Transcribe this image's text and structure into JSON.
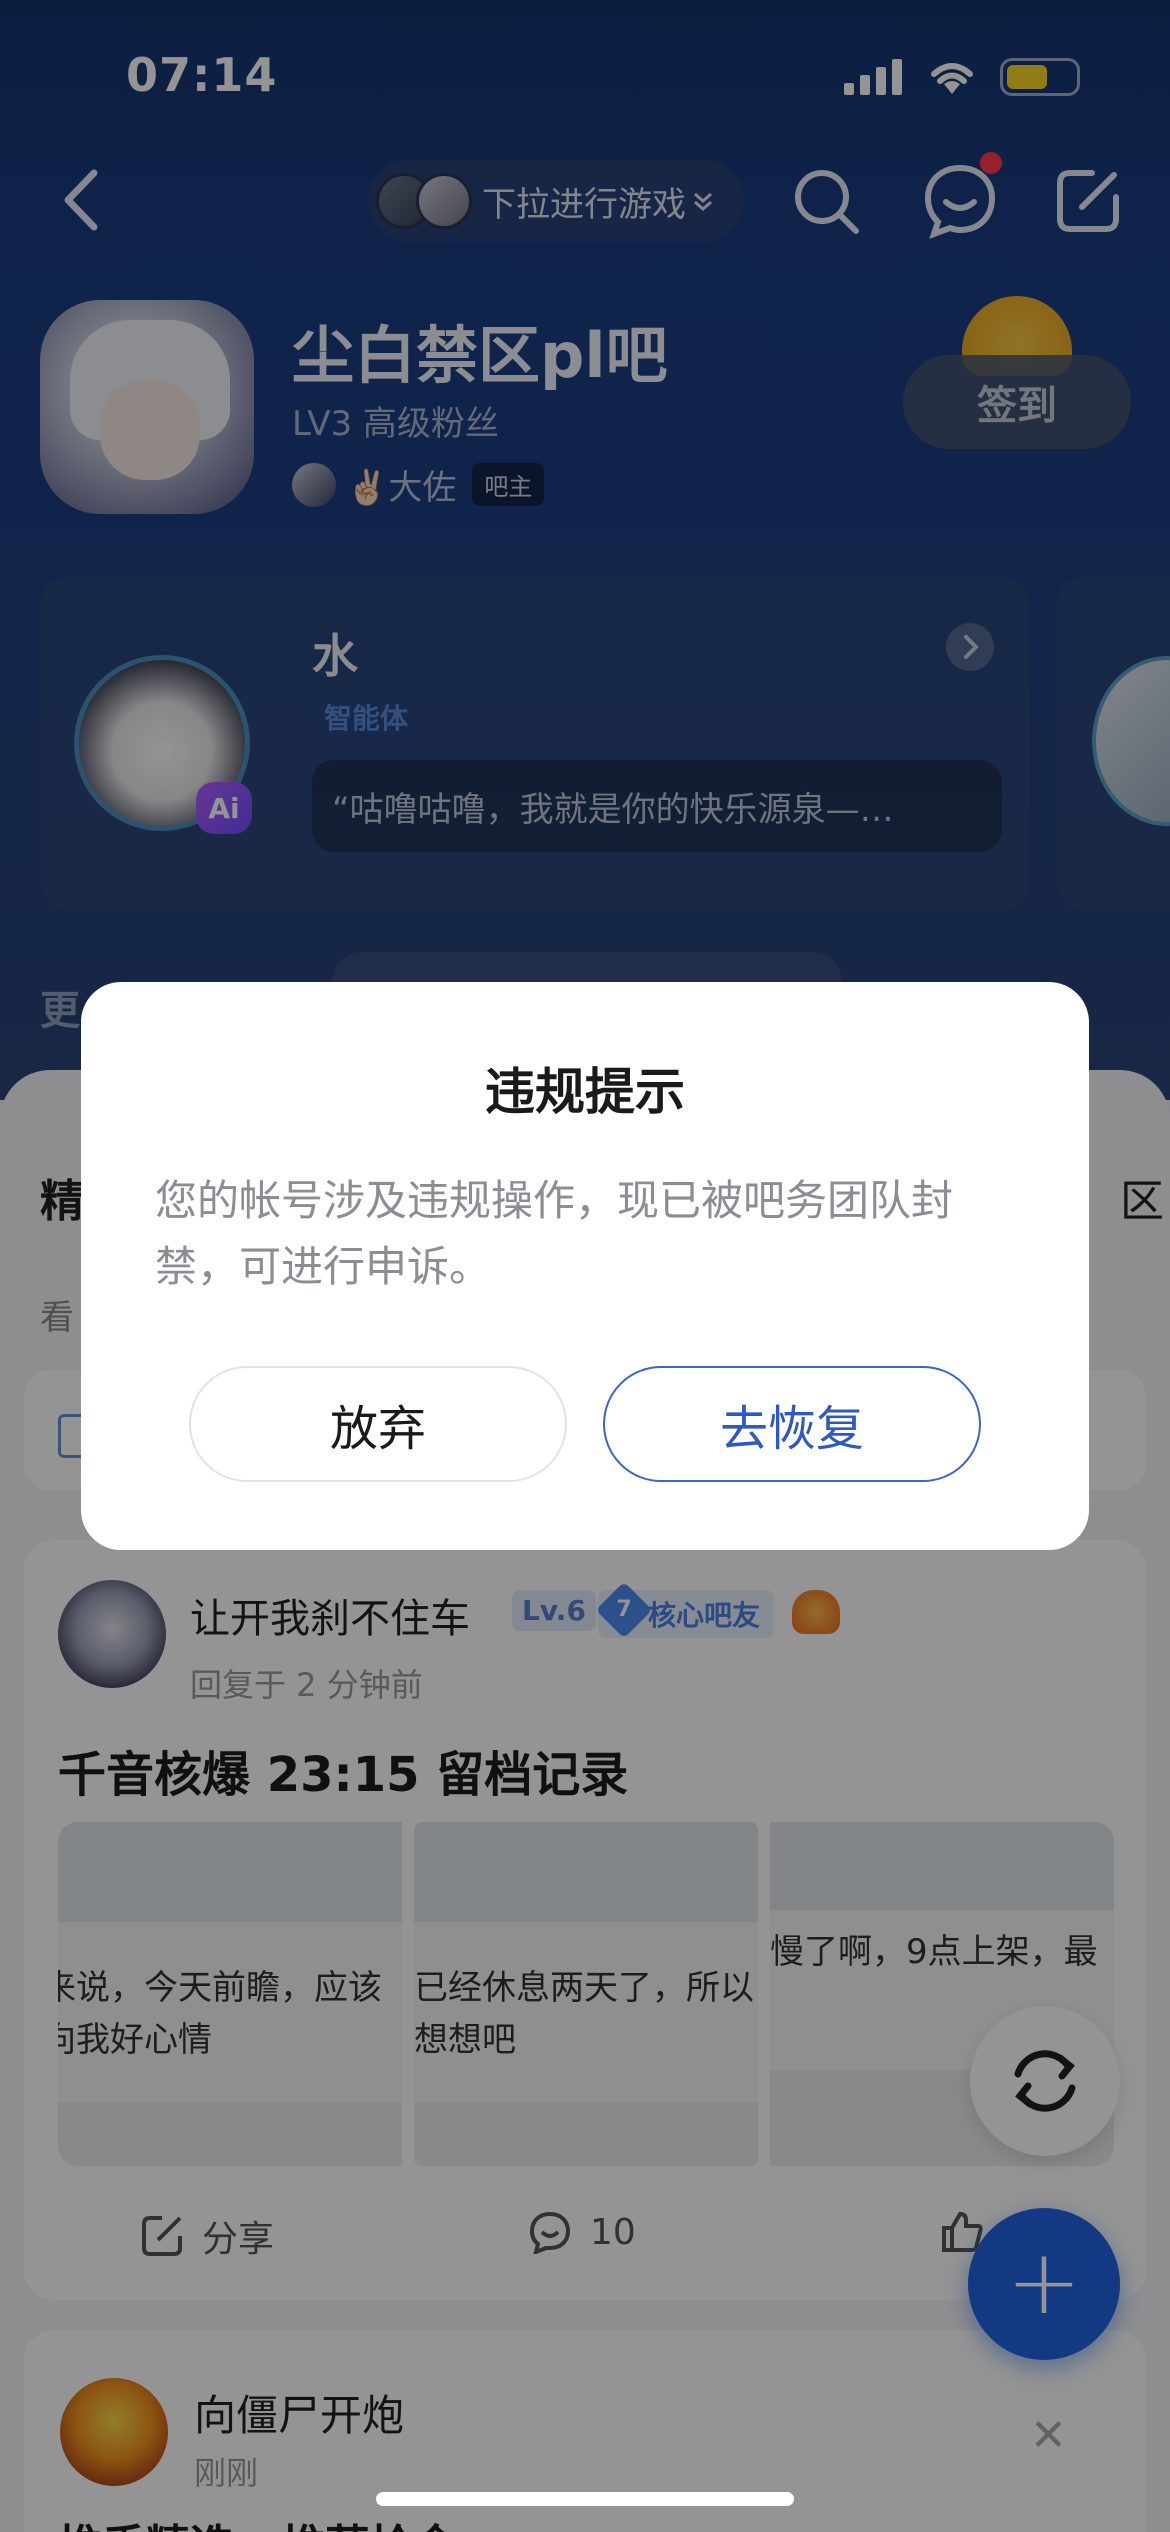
{
  "status_bar": {
    "time": "07:14"
  },
  "top_nav": {
    "game_pill_label": "下拉进行游戏"
  },
  "forum": {
    "name": "尘白禁区pl吧",
    "level": "LV3 高级粉丝",
    "owner_name": "✌🏻大佐",
    "owner_badge": "吧主",
    "checkin_label": "签到"
  },
  "agent_card": {
    "name": "水",
    "tag": "智能体",
    "quote": "“咕噜咕噜，我就是你的快乐源泉—…",
    "ai_badge": "Ai"
  },
  "background_fragments": {
    "more_text": "更",
    "tab_left": "精",
    "tab_right": "区",
    "sort_left": "看"
  },
  "post": {
    "author": "让开我刹不住车",
    "level_badge": "Lv.6",
    "core_badge_num": "7",
    "core_badge": "核心吧友",
    "time": "回复于 2 分钟前",
    "title": "千音核爆 23:15 留档记录",
    "thumbs": [
      {
        "line1": "来说，今天前瞻，应该",
        "line2": "向我好心情"
      },
      {
        "line1": "已经休息两天了，所以",
        "line2": "想想吧"
      },
      {
        "line1": "慢了啊，9点上架，最",
        "line2": ""
      }
    ],
    "share_label": "分享",
    "comment_count": "10"
  },
  "post2": {
    "author": "向僵尸开炮",
    "time": "刚刚",
    "title": "推手精选 · 推荐拾金"
  },
  "fab": {
    "label": "+"
  },
  "dialog": {
    "title": "违规提示",
    "message": "您的帐号涉及违规操作，现已被吧务团队封禁，可进行申诉。",
    "cancel_label": "放弃",
    "confirm_label": "去恢复"
  },
  "colors": {
    "header_bg": "#1d3f82",
    "accent": "#2e59c4",
    "fab": "#1f63e0"
  }
}
